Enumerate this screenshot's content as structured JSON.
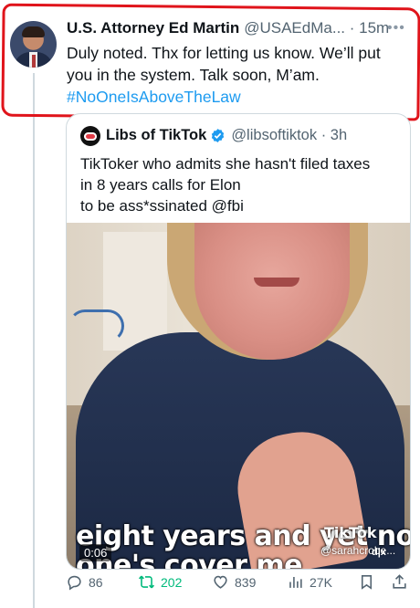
{
  "tweet": {
    "author_name": "U.S. Attorney Ed Martin",
    "handle": "@USAEdMa...",
    "time": "15m",
    "text_line1": "Duly noted. Thx for letting us know. We’ll put",
    "text_line2": "you in the system. Talk soon, M’am.",
    "hashtag": "#NoOneIsAboveTheLaw"
  },
  "quote": {
    "author_name": "Libs of TikTok",
    "handle": "@libsoftiktok",
    "time": "3h",
    "text_line1": "TikToker who admits she hasn't filed taxes",
    "text_line2": "in 8 years calls for Elon",
    "text_line3": "to be ass*ssinated @fbi",
    "video": {
      "caption_line1": "eight years and yet no",
      "caption_line2": "one's cover me",
      "watermark": "TikTok",
      "watermark_handle": "@sarahcrobe...",
      "duration": "0:06",
      "badge": "d|x"
    }
  },
  "actions": {
    "replies": "86",
    "reposts": "202",
    "likes": "839",
    "views": "27K"
  },
  "colors": {
    "accent": "#1d9bf0",
    "repost": "#00ba7c",
    "highlight_oval": "#e0141b",
    "muted": "#536471"
  },
  "icons": [
    "more-icon",
    "verified-icon",
    "reply-icon",
    "repost-icon",
    "like-icon",
    "views-icon",
    "bookmark-icon",
    "share-icon"
  ]
}
